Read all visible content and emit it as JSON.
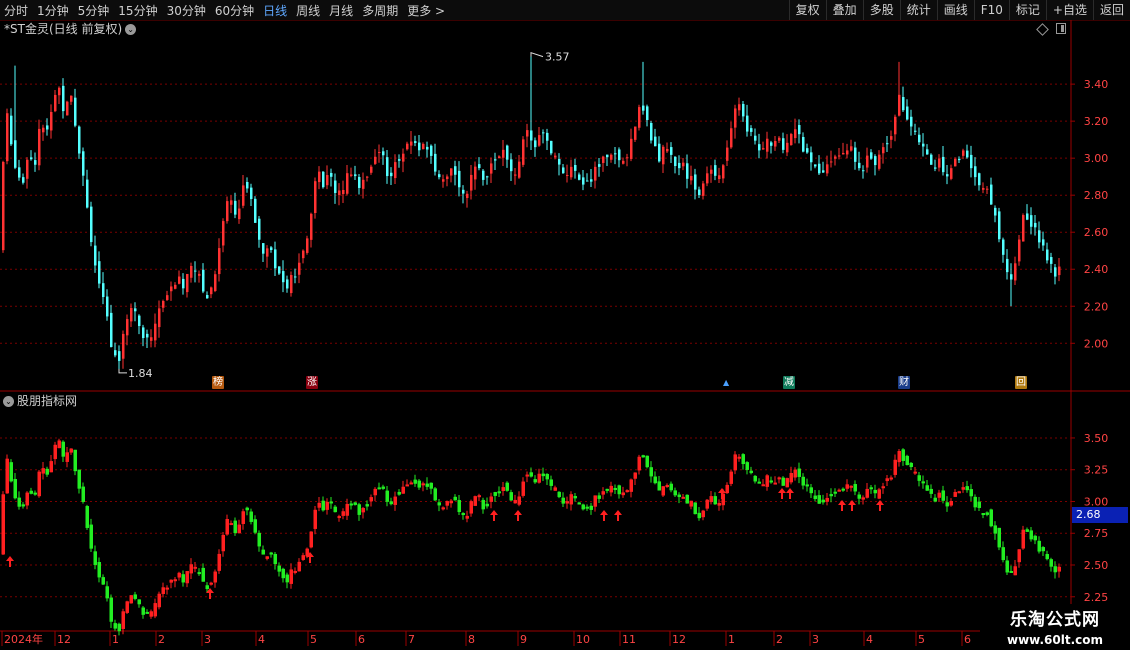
{
  "toolbar": {
    "periods": [
      "分时",
      "1分钟",
      "5分钟",
      "15分钟",
      "30分钟",
      "60分钟",
      "日线",
      "周线",
      "月线",
      "多周期",
      "更多 >"
    ],
    "active_period": "日线",
    "right_buttons": [
      "复权",
      "叠加",
      "多股",
      "统计",
      "画线",
      "F10",
      "标记",
      "+自选",
      "返回"
    ]
  },
  "stock": {
    "title": "*ST金灵(日线 前复权)"
  },
  "indicator": {
    "title": "股朋指标网"
  },
  "price_axis": {
    "labels": [
      "3.40",
      "3.20",
      "3.00",
      "2.80",
      "2.60",
      "2.40",
      "2.20",
      "2.00"
    ],
    "range": [
      1.78,
      3.66
    ]
  },
  "indicator_axis": {
    "labels": [
      "3.50",
      "3.25",
      "3.00",
      "2.75",
      "2.50",
      "2.25"
    ],
    "range": [
      2.02,
      3.72
    ]
  },
  "annotations": {
    "high": "3.57",
    "low": "1.84"
  },
  "badges": [
    {
      "label": "榜",
      "color": "#b65a10"
    },
    {
      "label": "涨",
      "color": "#8a0010"
    },
    {
      "label": "▲",
      "color": "#000000"
    },
    {
      "label": "减",
      "color": "#0e7a5a"
    },
    {
      "label": "财",
      "color": "#1a3d8a"
    },
    {
      "label": "回",
      "color": "#b07a10"
    }
  ],
  "current_value_tag": "2.68",
  "time_axis": [
    "2024年",
    "12",
    "1",
    "2",
    "3",
    "4",
    "5",
    "6",
    "7",
    "8",
    "9",
    "10",
    "11",
    "12",
    "1",
    "2",
    "3",
    "4",
    "5",
    "6"
  ],
  "watermark": {
    "line1": "乐淘公式网",
    "line2": "www.60lt.com"
  },
  "colors": {
    "up": "#ff3232",
    "down": "#54ffff",
    "ind_up": "#ff2020",
    "ind_down": "#22ee22",
    "grid": "#7a0000",
    "axis_text": "#ff4444",
    "active": "#5fa8ff"
  },
  "chart_data": {
    "type": "candlestick",
    "approx_close_path": [
      [
        0,
        2.5
      ],
      [
        5,
        3.3
      ],
      [
        10,
        3.1
      ],
      [
        16,
        2.95
      ],
      [
        22,
        2.85
      ],
      [
        28,
        3.05
      ],
      [
        34,
        2.95
      ],
      [
        40,
        3.2
      ],
      [
        46,
        3.1
      ],
      [
        52,
        3.3
      ],
      [
        58,
        3.4
      ],
      [
        64,
        3.25
      ],
      [
        70,
        3.4
      ],
      [
        76,
        3.15
      ],
      [
        82,
        2.95
      ],
      [
        88,
        2.7
      ],
      [
        94,
        2.45
      ],
      [
        100,
        2.3
      ],
      [
        106,
        2.15
      ],
      [
        112,
        1.95
      ],
      [
        118,
        1.9
      ],
      [
        124,
        2.1
      ],
      [
        130,
        2.2
      ],
      [
        136,
        2.15
      ],
      [
        142,
        2.05
      ],
      [
        148,
        2.0
      ],
      [
        154,
        2.1
      ],
      [
        160,
        2.2
      ],
      [
        166,
        2.25
      ],
      [
        172,
        2.3
      ],
      [
        178,
        2.35
      ],
      [
        184,
        2.3
      ],
      [
        190,
        2.45
      ],
      [
        196,
        2.4
      ],
      [
        202,
        2.3
      ],
      [
        208,
        2.25
      ],
      [
        214,
        2.35
      ],
      [
        220,
        2.55
      ],
      [
        226,
        2.8
      ],
      [
        232,
        2.75
      ],
      [
        238,
        2.7
      ],
      [
        244,
        2.85
      ],
      [
        250,
        2.8
      ],
      [
        256,
        2.65
      ],
      [
        262,
        2.5
      ],
      [
        268,
        2.55
      ],
      [
        274,
        2.45
      ],
      [
        280,
        2.35
      ],
      [
        286,
        2.3
      ],
      [
        292,
        2.35
      ],
      [
        298,
        2.4
      ],
      [
        304,
        2.5
      ],
      [
        310,
        2.65
      ],
      [
        316,
        2.95
      ],
      [
        322,
        2.85
      ],
      [
        328,
        2.9
      ],
      [
        334,
        2.85
      ],
      [
        340,
        2.8
      ],
      [
        346,
        2.9
      ],
      [
        352,
        2.95
      ],
      [
        358,
        2.85
      ],
      [
        364,
        2.9
      ],
      [
        370,
        2.95
      ],
      [
        376,
        3.0
      ],
      [
        382,
        3.05
      ],
      [
        388,
        2.9
      ],
      [
        394,
        2.95
      ],
      [
        400,
        3.0
      ],
      [
        406,
        3.05
      ],
      [
        412,
        3.1
      ],
      [
        418,
        3.05
      ],
      [
        424,
        3.1
      ],
      [
        430,
        3.0
      ],
      [
        436,
        2.9
      ],
      [
        442,
        2.85
      ],
      [
        448,
        2.9
      ],
      [
        454,
        2.95
      ],
      [
        460,
        2.85
      ],
      [
        466,
        2.8
      ],
      [
        472,
        2.9
      ],
      [
        478,
        2.95
      ],
      [
        484,
        2.9
      ],
      [
        490,
        2.95
      ],
      [
        496,
        3.0
      ],
      [
        502,
        3.05
      ],
      [
        508,
        2.95
      ],
      [
        514,
        2.9
      ],
      [
        520,
        3.0
      ],
      [
        526,
        3.15
      ],
      [
        532,
        3.05
      ],
      [
        538,
        3.1
      ],
      [
        544,
        3.15
      ],
      [
        550,
        3.05
      ],
      [
        556,
        3.0
      ],
      [
        562,
        2.95
      ],
      [
        568,
        2.9
      ],
      [
        574,
        2.95
      ],
      [
        580,
        2.9
      ],
      [
        586,
        2.85
      ],
      [
        592,
        2.9
      ],
      [
        598,
        2.95
      ],
      [
        604,
        3.0
      ],
      [
        610,
        3.05
      ],
      [
        616,
        3.0
      ],
      [
        622,
        2.95
      ],
      [
        628,
        3.05
      ],
      [
        634,
        3.15
      ],
      [
        640,
        3.3
      ],
      [
        646,
        3.2
      ],
      [
        652,
        3.1
      ],
      [
        658,
        3.0
      ],
      [
        664,
        3.05
      ],
      [
        670,
        3.0
      ],
      [
        676,
        2.95
      ],
      [
        682,
        3.0
      ],
      [
        688,
        2.9
      ],
      [
        694,
        2.85
      ],
      [
        700,
        2.8
      ],
      [
        706,
        2.9
      ],
      [
        712,
        2.95
      ],
      [
        718,
        2.9
      ],
      [
        724,
        3.0
      ],
      [
        730,
        3.15
      ],
      [
        736,
        3.3
      ],
      [
        742,
        3.25
      ],
      [
        748,
        3.15
      ],
      [
        754,
        3.1
      ],
      [
        760,
        3.05
      ],
      [
        766,
        3.1
      ],
      [
        772,
        3.05
      ],
      [
        778,
        3.1
      ],
      [
        784,
        3.05
      ],
      [
        790,
        3.1
      ],
      [
        796,
        3.2
      ],
      [
        802,
        3.05
      ],
      [
        808,
        3.0
      ],
      [
        814,
        2.95
      ],
      [
        820,
        2.9
      ],
      [
        826,
        2.95
      ],
      [
        832,
        3.0
      ],
      [
        838,
        3.05
      ],
      [
        844,
        3.0
      ],
      [
        850,
        3.05
      ],
      [
        856,
        3.0
      ],
      [
        862,
        2.95
      ],
      [
        868,
        3.0
      ],
      [
        874,
        2.95
      ],
      [
        880,
        3.05
      ],
      [
        886,
        3.1
      ],
      [
        892,
        3.15
      ],
      [
        898,
        3.35
      ],
      [
        904,
        3.25
      ],
      [
        910,
        3.2
      ],
      [
        916,
        3.1
      ],
      [
        922,
        3.05
      ],
      [
        928,
        3.0
      ],
      [
        934,
        2.95
      ],
      [
        940,
        3.0
      ],
      [
        946,
        2.9
      ],
      [
        952,
        2.95
      ],
      [
        958,
        3.0
      ],
      [
        964,
        3.05
      ],
      [
        970,
        2.95
      ],
      [
        976,
        2.9
      ],
      [
        982,
        2.85
      ],
      [
        988,
        2.8
      ],
      [
        994,
        2.7
      ],
      [
        1000,
        2.55
      ],
      [
        1006,
        2.4
      ],
      [
        1012,
        2.35
      ],
      [
        1018,
        2.55
      ],
      [
        1024,
        2.7
      ],
      [
        1030,
        2.65
      ],
      [
        1036,
        2.6
      ],
      [
        1042,
        2.55
      ],
      [
        1048,
        2.45
      ],
      [
        1054,
        2.35
      ],
      [
        1060,
        2.4
      ]
    ]
  }
}
